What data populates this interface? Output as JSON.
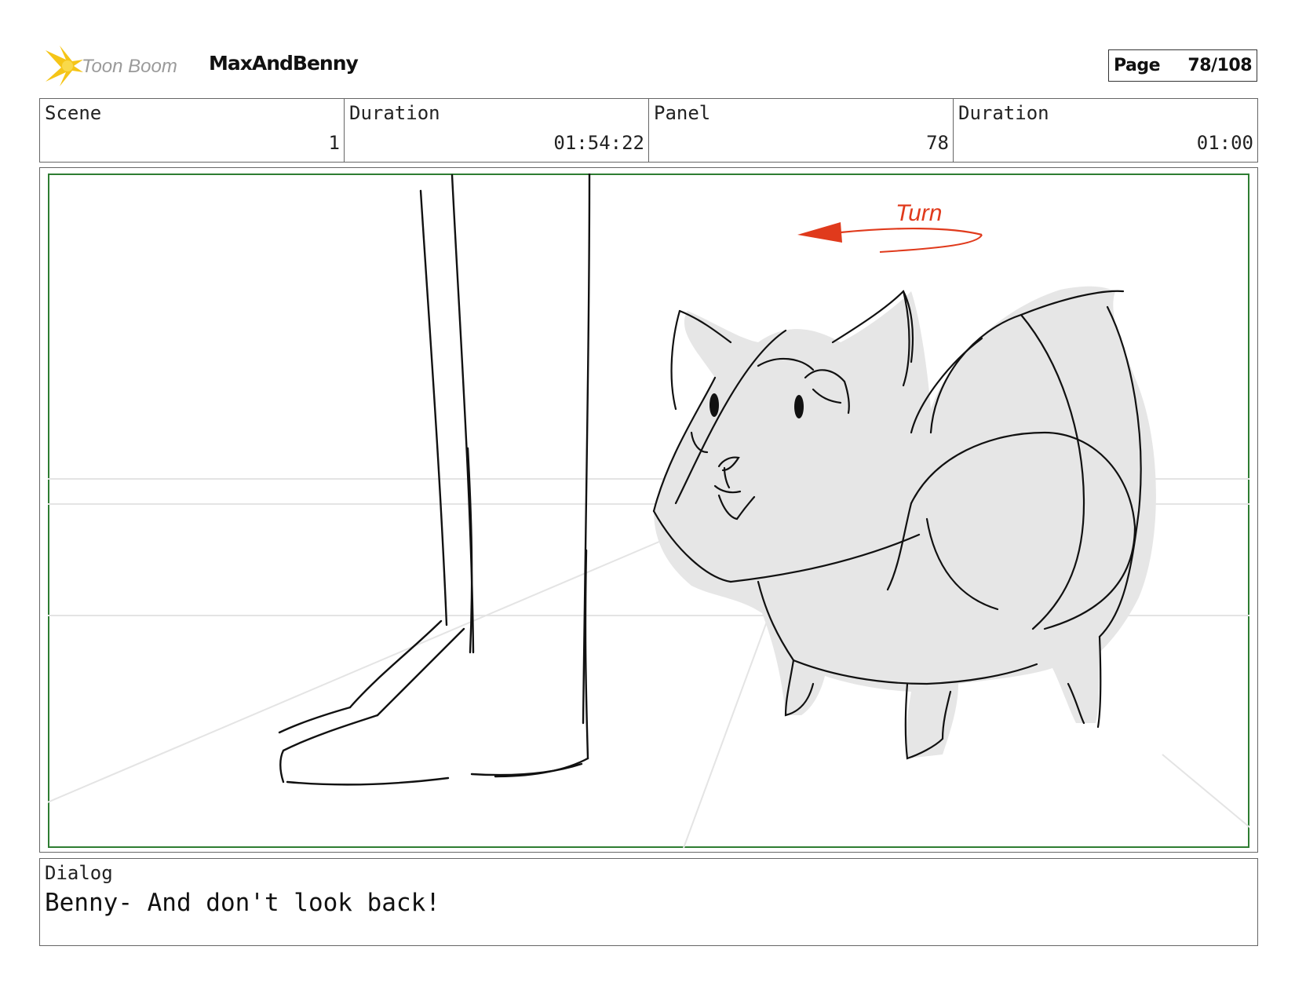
{
  "header": {
    "brand_name": "Toon Boom",
    "project_title": "MaxAndBenny",
    "page_label": "Page",
    "page_value": "78/108"
  },
  "info": {
    "scene_label": "Scene",
    "scene_value": "1",
    "scene_duration_label": "Duration",
    "scene_duration_value": "01:54:22",
    "panel_label": "Panel",
    "panel_value": "78",
    "panel_duration_label": "Duration",
    "panel_duration_value": "01:00"
  },
  "panel": {
    "annotation": "Turn",
    "annotation_color": "#e03a1c",
    "frame_color": "#2e7d32"
  },
  "dialog": {
    "label": "Dialog",
    "text": "Benny- And don't look back!"
  },
  "colors": {
    "logo_yellow": "#f5c518",
    "logo_text": "#9a9a9a",
    "fill_gray": "#e6e6e6"
  }
}
